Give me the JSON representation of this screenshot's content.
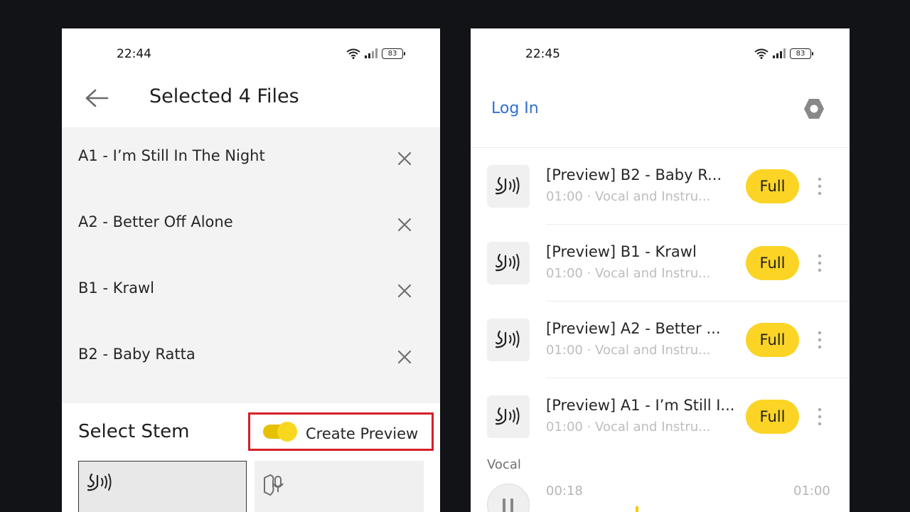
{
  "left_screen": {
    "status_time": "22:44",
    "battery": "83",
    "title": "Selected 4 Files",
    "files": [
      {
        "name": "A1 - I’m Still In The Night"
      },
      {
        "name": "A2 - Better Off Alone"
      },
      {
        "name": "B1 - Krawl"
      },
      {
        "name": "B2 - Baby Ratta"
      }
    ],
    "stem_title": "Select Stem",
    "create_preview_label": "Create Preview",
    "create_preview_on": true,
    "accent_color": "#fbd426",
    "highlight_color": "#d32029"
  },
  "right_screen": {
    "status_time": "22:45",
    "battery": "83",
    "login_label": "Log In",
    "tracks": [
      {
        "title": "[Preview] B2 - Baby R...",
        "subtitle": "01:00 · Vocal and Instru...",
        "button": "Full"
      },
      {
        "title": "[Preview] B1 - Krawl",
        "subtitle": "01:00 · Vocal and Instru...",
        "button": "Full"
      },
      {
        "title": "[Preview] A2 - Better ...",
        "subtitle": "01:00 · Vocal and Instru...",
        "button": "Full"
      },
      {
        "title": "[Preview] A1 - I’m Still I...",
        "subtitle": "01:00 · Vocal and Instru...",
        "button": "Full"
      }
    ],
    "player": {
      "section_label": "Vocal",
      "current_time": "00:18",
      "total_time": "01:00"
    },
    "link_color": "#2f6fd0"
  }
}
